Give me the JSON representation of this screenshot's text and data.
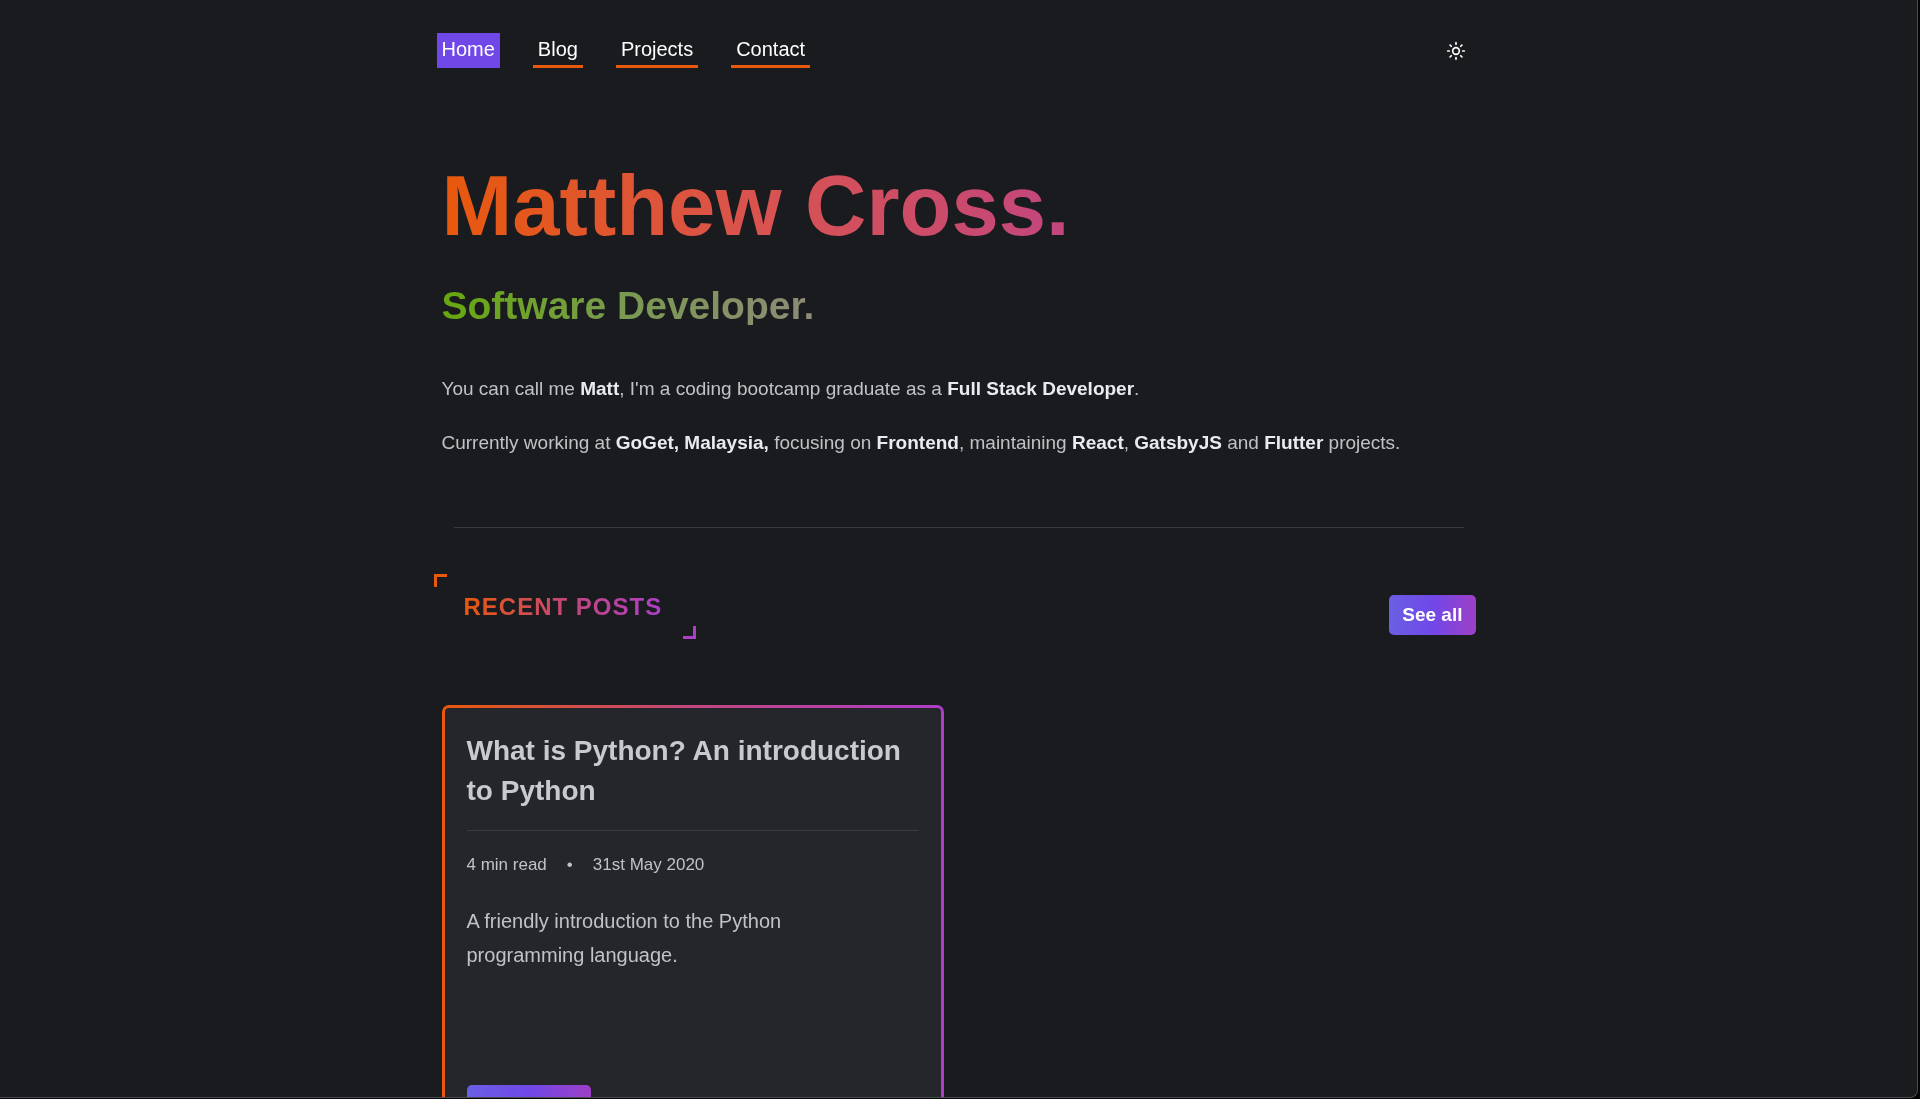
{
  "nav": {
    "items": [
      {
        "label": "Home",
        "selected": true
      },
      {
        "label": "Blog",
        "selected": false
      },
      {
        "label": "Projects",
        "selected": false
      },
      {
        "label": "Contact",
        "selected": false
      }
    ]
  },
  "hero": {
    "name": "Matthew Cross.",
    "role": "Software Developer.",
    "paragraphs": [
      "You can call me **Matt**, I'm a coding bootcamp graduate as a **Full Stack Developer**.",
      "Currently working at **GoGet, Malaysia,** focusing on **Frontend**, maintaining **React**, **GatsbyJS** and **Flutter** projects."
    ]
  },
  "recent_posts": {
    "heading": "RECENT POSTS",
    "see_all": "See all",
    "posts": [
      {
        "title": "What is Python? An introduction to Python",
        "read_time": "4 min read",
        "separator": "•",
        "date": "31st May 2020",
        "excerpt": "A friendly introduction to the Python programming language."
      }
    ]
  }
}
